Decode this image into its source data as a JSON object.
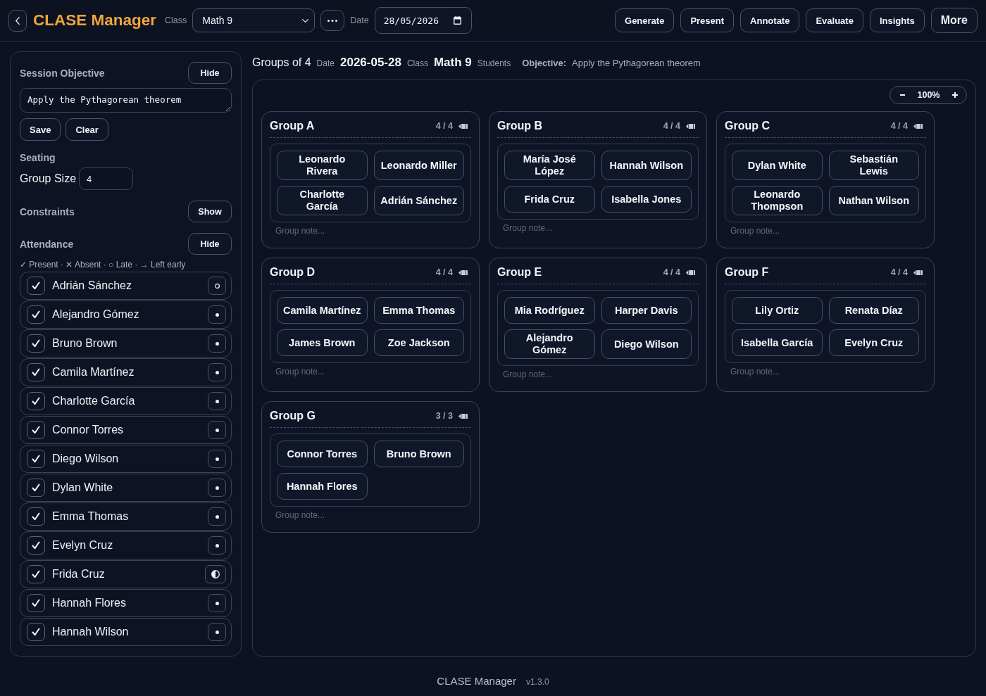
{
  "header": {
    "app_title": "CLASE Manager",
    "class_label": "Class",
    "class_select": {
      "value": "Math 9"
    },
    "date_label": "Date",
    "date_field": {
      "value": "28/05/2026"
    },
    "actions": [
      {
        "label": "Generate",
        "kind": "action"
      },
      {
        "label": "Present",
        "kind": "action"
      },
      {
        "label": "Annotate",
        "kind": "action"
      },
      {
        "label": "Evaluate",
        "kind": "action"
      },
      {
        "label": "Insights",
        "kind": "action"
      },
      {
        "label": "More",
        "kind": "menu"
      }
    ]
  },
  "sidebar": {
    "objective": {
      "title": "Session Objective",
      "toggle": "Hide",
      "value": "Apply the Pythagorean theorem",
      "buttons": [
        "Save",
        "Clear"
      ]
    },
    "seating": {
      "title": "Seating",
      "label": "Group Size",
      "value": "4"
    },
    "constraints": {
      "title": "Constraints",
      "toggle": "Show"
    },
    "attendance": {
      "title": "Attendance",
      "toggle": "Hide",
      "legend": "✓ Present · ✕ Absent · ○ Late · → Left early",
      "students": [
        {
          "name": "Adrián Sánchez",
          "checked": true,
          "kind": "ring"
        },
        {
          "name": "Alejandro Gómez",
          "checked": true,
          "kind": "dot"
        },
        {
          "name": "Bruno Brown",
          "checked": true,
          "kind": "dot"
        },
        {
          "name": "Camila Martínez",
          "checked": true,
          "kind": "dot"
        },
        {
          "name": "Charlotte García",
          "checked": true,
          "kind": "dot"
        },
        {
          "name": "Connor Torres",
          "checked": true,
          "kind": "dot"
        },
        {
          "name": "Diego Wilson",
          "checked": true,
          "kind": "dot"
        },
        {
          "name": "Dylan White",
          "checked": true,
          "kind": "dot"
        },
        {
          "name": "Emma Thomas",
          "checked": true,
          "kind": "dot"
        },
        {
          "name": "Evelyn Cruz",
          "checked": true,
          "kind": "dot"
        },
        {
          "name": "Frida Cruz",
          "checked": true,
          "kind": "half"
        },
        {
          "name": "Hannah Flores",
          "checked": true,
          "kind": "dot"
        },
        {
          "name": "Hannah Wilson",
          "checked": true,
          "kind": "dot"
        }
      ]
    }
  },
  "main": {
    "summary": {
      "title": "Groups of 4",
      "fields": [
        {
          "label": "Date",
          "value": "2026-05-28"
        },
        {
          "label": "Class",
          "value": "Math 9"
        },
        {
          "label": "Students"
        }
      ],
      "objective": {
        "label": "Objective:",
        "value": "Apply the Pythagorean theorem"
      }
    },
    "zoom": {
      "value": "100%"
    },
    "groups": [
      {
        "name": "Group A",
        "count": "4 / 4",
        "members": [
          "Leonardo Rivera",
          "Leonardo Miller",
          "Charlotte García",
          "Adrián Sánchez"
        ],
        "note": {
          "placeholder": "Group note..."
        }
      },
      {
        "name": "Group B",
        "count": "4 / 4",
        "members": [
          "María José López",
          "Hannah Wilson",
          "Frida Cruz",
          "Isabella Jones"
        ],
        "note": {
          "placeholder": "Group note..."
        }
      },
      {
        "name": "Group C",
        "count": "4 / 4",
        "members": [
          "Dylan White",
          "Sebastián Lewis",
          "Leonardo Thompson",
          "Nathan Wilson"
        ],
        "note": {
          "placeholder": "Group note..."
        }
      },
      {
        "name": "Group D",
        "count": "4 / 4",
        "members": [
          "Camila Martínez",
          "Emma Thomas",
          "James Brown",
          "Zoe Jackson"
        ],
        "note": {
          "placeholder": "Group note..."
        }
      },
      {
        "name": "Group E",
        "count": "4 / 4",
        "members": [
          "Mia Rodríguez",
          "Harper Davis",
          "Alejandro Gómez",
          "Diego Wilson"
        ],
        "note": {
          "placeholder": "Group note..."
        }
      },
      {
        "name": "Group F",
        "count": "4 / 4",
        "members": [
          "Lily Ortiz",
          "Renata Díaz",
          "Isabella García",
          "Evelyn Cruz"
        ],
        "note": {
          "placeholder": "Group note..."
        }
      },
      {
        "name": "Group G",
        "count": "3 / 3",
        "members": [
          "Connor Torres",
          "Bruno Brown",
          "Hannah Flores"
        ],
        "note": {
          "placeholder": "Group note..."
        }
      }
    ]
  },
  "footer": {
    "app_name": "CLASE Manager",
    "version": "v1.3.0"
  }
}
